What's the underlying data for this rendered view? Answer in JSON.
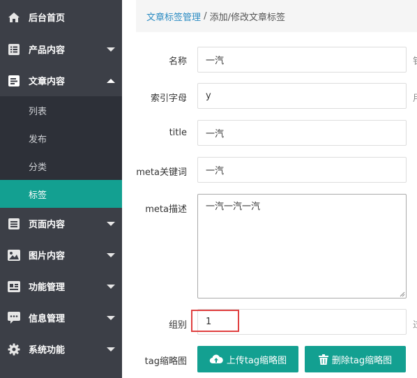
{
  "sidebar": {
    "items": [
      {
        "label": "后台首页",
        "icon": "home-icon"
      },
      {
        "label": "产品内容",
        "icon": "list-icon"
      },
      {
        "label": "文章内容",
        "icon": "article-icon"
      },
      {
        "label": "页面内容",
        "icon": "page-icon"
      },
      {
        "label": "图片内容",
        "icon": "image-icon"
      },
      {
        "label": "功能管理",
        "icon": "feature-icon"
      },
      {
        "label": "信息管理",
        "icon": "message-icon"
      },
      {
        "label": "系统功能",
        "icon": "gear-icon"
      }
    ],
    "subitems": [
      {
        "label": "列表"
      },
      {
        "label": "发布"
      },
      {
        "label": "分类"
      },
      {
        "label": "标签",
        "active": true
      }
    ]
  },
  "breadcrumb": {
    "link": "文章标签管理",
    "separator": " / ",
    "current": "添加/修改文章标签"
  },
  "form": {
    "name_label": "名称",
    "name_value": "一汽",
    "name_hint": "钅",
    "index_label": "索引字母",
    "index_value": "y",
    "index_hint": "用",
    "title_label": "title",
    "title_value": "一汽",
    "keywords_label": "meta关键词",
    "keywords_value": "一汽",
    "desc_label": "meta描述",
    "desc_value": "一汽一汽一汽",
    "group_label": "组别",
    "group_value": "1",
    "group_hint": "过",
    "thumb_label": "tag缩略图",
    "upload_button": "上传tag缩略图",
    "delete_button": "删除tag缩略图"
  },
  "colors": {
    "sidebar_bg": "#3c3f47",
    "submenu_bg": "#2d3038",
    "accent": "#13a091",
    "link": "#2a8bc2",
    "highlight": "#e04040"
  }
}
